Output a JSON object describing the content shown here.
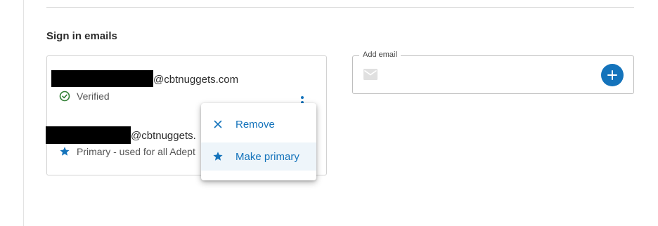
{
  "section": {
    "title": "Sign in emails"
  },
  "emails": [
    {
      "suffix": "@cbtnuggets.com",
      "status": "Verified",
      "status_icon": "check-circle-icon"
    },
    {
      "suffix": "@cbtnuggets.",
      "status": "Primary - used for all Adept",
      "status_icon": "star-icon"
    }
  ],
  "menu": {
    "items": [
      {
        "label": "Remove",
        "icon": "close-icon"
      },
      {
        "label": "Make primary",
        "icon": "star-icon"
      }
    ]
  },
  "add_email": {
    "label": "Add email",
    "placeholder": "",
    "icon": "mail-icon",
    "button_icon": "plus-icon"
  },
  "colors": {
    "accent": "#1473bb",
    "verified": "#2e7d32",
    "redaction": "#000000",
    "menu_hover": "#eef5fa"
  }
}
